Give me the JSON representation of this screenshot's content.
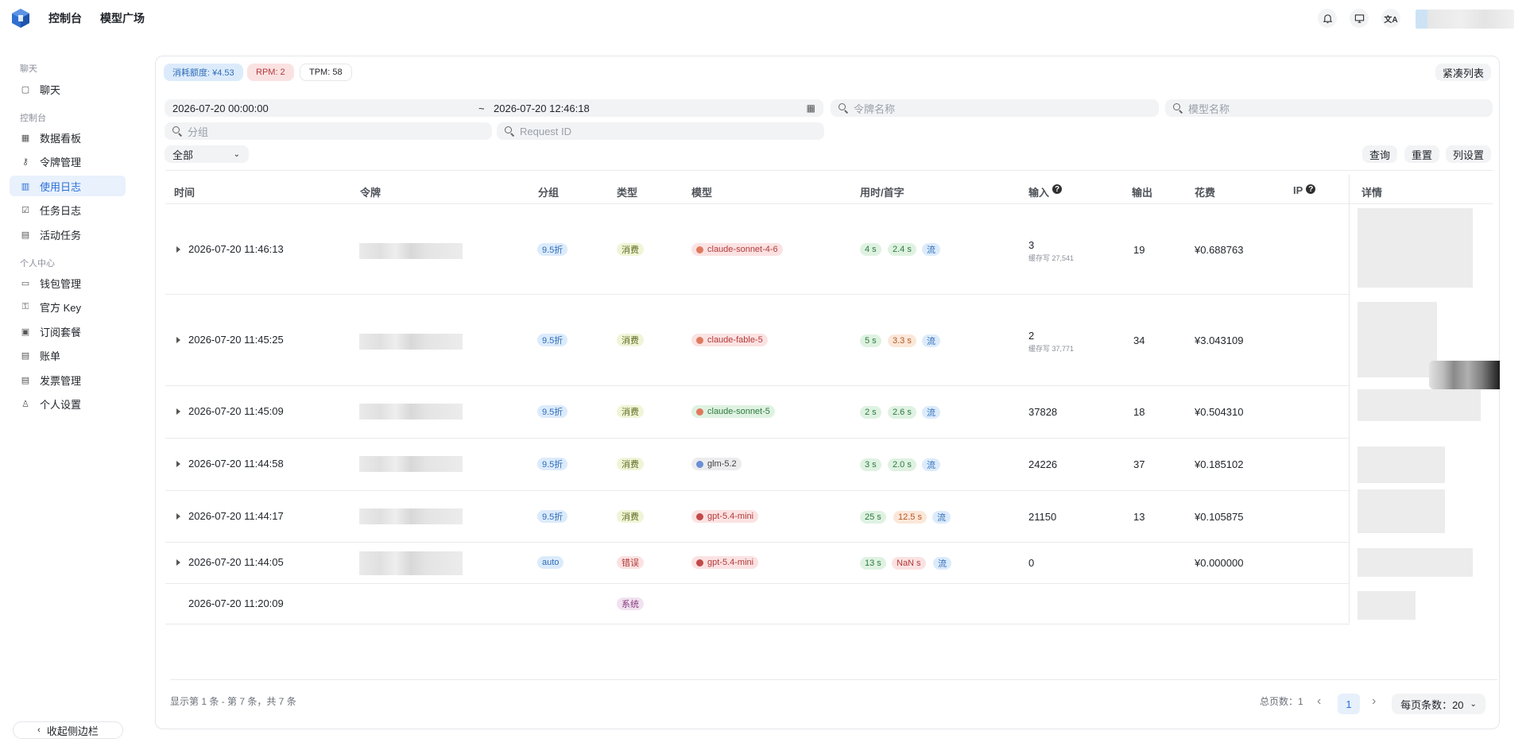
{
  "topbar": {
    "nav": [
      "控制台",
      "模型广场"
    ],
    "icons": [
      "bell-icon",
      "monitor-icon",
      "translate-icon"
    ]
  },
  "sidebar": {
    "sections": [
      {
        "title": "聊天",
        "items": [
          {
            "label": "聊天",
            "icon": "chat-icon"
          }
        ]
      },
      {
        "title": "控制台",
        "items": [
          {
            "label": "数据看板",
            "icon": "dashboard-icon"
          },
          {
            "label": "令牌管理",
            "icon": "key-icon"
          },
          {
            "label": "使用日志",
            "icon": "chart-icon",
            "active": true
          },
          {
            "label": "任务日志",
            "icon": "checklist-icon"
          },
          {
            "label": "活动任务",
            "icon": "clipboard-icon"
          }
        ]
      },
      {
        "title": "个人中心",
        "items": [
          {
            "label": "钱包管理",
            "icon": "wallet-icon"
          },
          {
            "label": "官方 Key",
            "icon": "key-alt-icon"
          },
          {
            "label": "订阅套餐",
            "icon": "calendar-icon"
          },
          {
            "label": "账单",
            "icon": "receipt-icon"
          },
          {
            "label": "发票管理",
            "icon": "invoice-icon"
          },
          {
            "label": "个人设置",
            "icon": "user-icon"
          }
        ]
      }
    ],
    "collapse_label": "收起侧边栏"
  },
  "stats": {
    "quota": "消耗额度: ¥4.53",
    "rpm": "RPM: 2",
    "tpm": "TPM: 58"
  },
  "compact_label": "紧凑列表",
  "filters": {
    "start_time": "2026-07-20 00:00:00",
    "separator": "~",
    "end_time": "2026-07-20 12:46:18",
    "token_placeholder": "令牌名称",
    "model_placeholder": "模型名称",
    "group_placeholder": "分组",
    "request_placeholder": "Request ID",
    "type_value": "全部",
    "query": "查询",
    "reset": "重置",
    "columns": "列设置"
  },
  "table": {
    "headers": [
      "时间",
      "令牌",
      "分组",
      "类型",
      "模型",
      "用时/首字",
      "输入",
      "输出",
      "花费",
      "IP",
      "详情"
    ],
    "rows": [
      {
        "time": "2026-07-20 11:46:13",
        "group": "9.5折",
        "type": "消费",
        "model": "claude-sonnet-4-6",
        "t1": "4 s",
        "t2": "2.4 s",
        "stream": "流",
        "input": "3",
        "cache": "缓存写 27,541",
        "output": "19",
        "cost": "¥0.688763"
      },
      {
        "time": "2026-07-20 11:45:25",
        "group": "9.5折",
        "type": "消费",
        "model": "claude-fable-5",
        "t1": "5 s",
        "t2": "3.3 s",
        "stream": "流",
        "input": "2",
        "cache": "缓存写 37,771",
        "output": "34",
        "cost": "¥3.043109"
      },
      {
        "time": "2026-07-20 11:45:09",
        "group": "9.5折",
        "type": "消费",
        "model": "claude-sonnet-5",
        "t1": "2 s",
        "t2": "2.6 s",
        "stream": "流",
        "input": "37828",
        "cache": "",
        "output": "18",
        "cost": "¥0.504310"
      },
      {
        "time": "2026-07-20 11:44:58",
        "group": "9.5折",
        "type": "消费",
        "model": "glm-5.2",
        "t1": "3 s",
        "t2": "2.0 s",
        "stream": "流",
        "input": "24226",
        "cache": "",
        "output": "37",
        "cost": "¥0.185102"
      },
      {
        "time": "2026-07-20 11:44:17",
        "group": "9.5折",
        "type": "消费",
        "model": "gpt-5.4-mini",
        "t1": "25 s",
        "t2": "12.5 s",
        "stream": "流",
        "input": "21150",
        "cache": "",
        "output": "13",
        "cost": "¥0.105875"
      },
      {
        "time": "2026-07-20 11:44:05",
        "group": "auto",
        "type": "错误",
        "model": "gpt-5.4-mini",
        "t1": "13 s",
        "t2": "NaN s",
        "stream": "流",
        "input": "0",
        "cache": "",
        "output": "",
        "cost": "¥0.000000"
      },
      {
        "time": "2026-07-20 11:20:09",
        "group": "",
        "type": "系统",
        "model": "",
        "t1": "",
        "t2": "",
        "stream": "",
        "input": "",
        "cache": "",
        "output": "",
        "cost": ""
      }
    ]
  },
  "footer": {
    "summary": "显示第 1 条 - 第 7 条，共 7 条",
    "total_pages": "总页数：1",
    "current_page": "1",
    "per_page": "每页条数：20"
  },
  "colors": {
    "accent": "#2b6fd6",
    "active_bg": "#e8f1fc"
  }
}
